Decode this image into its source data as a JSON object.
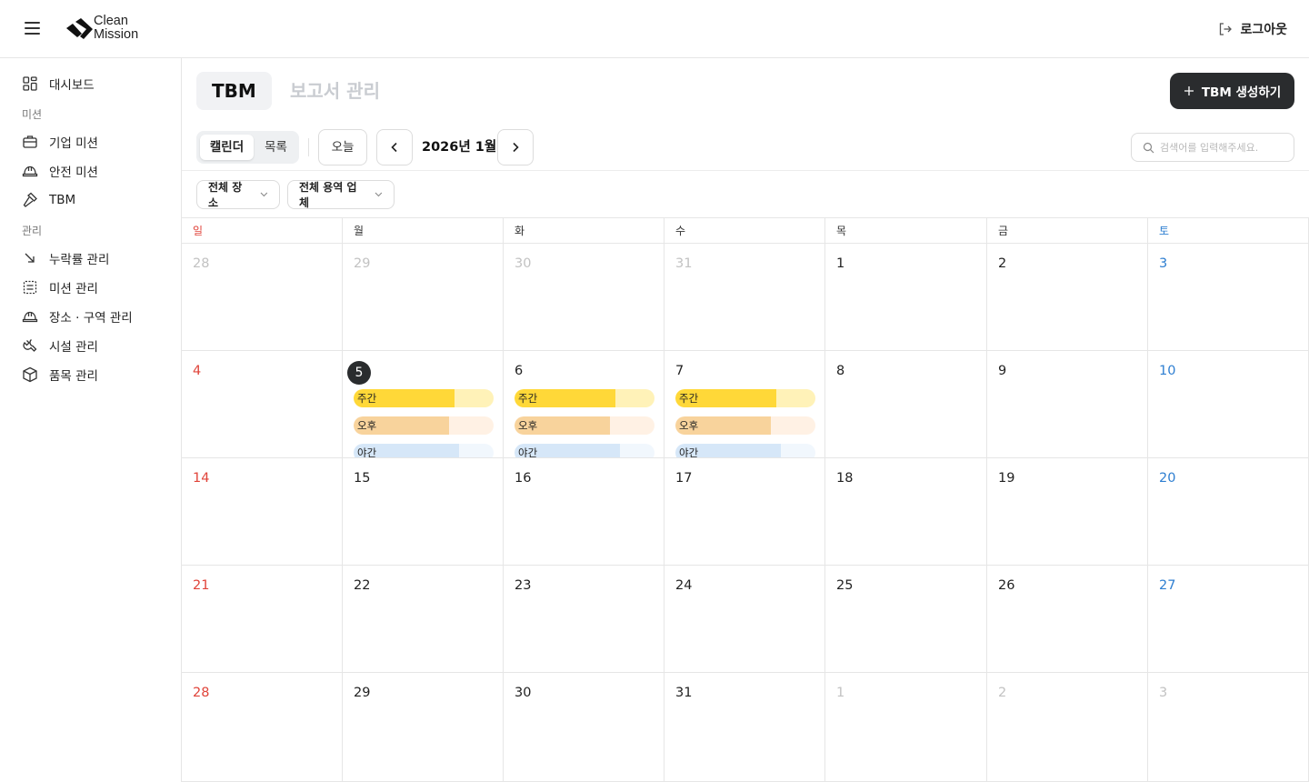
{
  "header": {
    "logo_line1": "Clean",
    "logo_line2": "Mission",
    "logout_label": "로그아웃"
  },
  "sidebar": {
    "items": [
      {
        "label": "대시보드",
        "icon": "dashboard-icon"
      },
      {
        "label": "기업 미션",
        "icon": "briefcase-icon"
      },
      {
        "label": "안전 미션",
        "icon": "hardhat-icon"
      },
      {
        "label": "TBM",
        "icon": "hammer-icon"
      },
      {
        "label": "누락률 관리",
        "icon": "arrow-down-right-icon"
      },
      {
        "label": "미션 관리",
        "icon": "checklist-icon"
      },
      {
        "label": "장소 · 구역 관리",
        "icon": "hardhat-icon"
      },
      {
        "label": "시설 관리",
        "icon": "wrench-icon"
      },
      {
        "label": "품목 관리",
        "icon": "box-icon"
      }
    ],
    "sections": [
      "미션",
      "관리"
    ]
  },
  "tabs": {
    "active": "TBM",
    "inactive": "보고서 관리"
  },
  "create_button_label": "TBM 생성하기",
  "view_toggle": {
    "calendar": "캘린더",
    "list": "목록"
  },
  "today_label": "오늘",
  "month_title": "2026년 1월",
  "search_placeholder": "검색어를 입력해주세요.",
  "filters": {
    "location": "전체 장소",
    "vendor": "전체 용역 업체"
  },
  "calendar": {
    "weekdays": [
      "일",
      "월",
      "화",
      "수",
      "목",
      "금",
      "토"
    ],
    "weeks": [
      [
        {
          "d": "28",
          "o": true
        },
        {
          "d": "29",
          "o": true
        },
        {
          "d": "30",
          "o": true
        },
        {
          "d": "31",
          "o": true
        },
        {
          "d": "1"
        },
        {
          "d": "2"
        },
        {
          "d": "3"
        }
      ],
      [
        {
          "d": "4"
        },
        {
          "d": "5",
          "today": true
        },
        {
          "d": "6"
        },
        {
          "d": "7"
        },
        {
          "d": "8"
        },
        {
          "d": "9"
        },
        {
          "d": "10"
        }
      ],
      [
        {
          "d": "14"
        },
        {
          "d": "15"
        },
        {
          "d": "16"
        },
        {
          "d": "17"
        },
        {
          "d": "18"
        },
        {
          "d": "19"
        },
        {
          "d": "20"
        }
      ],
      [
        {
          "d": "21"
        },
        {
          "d": "22"
        },
        {
          "d": "23"
        },
        {
          "d": "24"
        },
        {
          "d": "25"
        },
        {
          "d": "26"
        },
        {
          "d": "27"
        }
      ],
      [
        {
          "d": "28"
        },
        {
          "d": "29"
        },
        {
          "d": "30"
        },
        {
          "d": "31"
        },
        {
          "d": "1",
          "o": true
        },
        {
          "d": "2",
          "o": true
        },
        {
          "d": "3",
          "o": true
        }
      ]
    ],
    "shift_days": [
      "5",
      "6",
      "7"
    ],
    "shifts": [
      {
        "label": "주간",
        "progress": 0.72,
        "fill": "#ffd838",
        "track": "#fff2b8"
      },
      {
        "label": "오후",
        "progress": 0.68,
        "fill": "#f8d39c",
        "track": "#fff1e4"
      },
      {
        "label": "야간",
        "progress": 0.75,
        "fill": "#d6e7f8",
        "track": "#f1f7fd"
      }
    ]
  },
  "colors": {
    "sunday": "#e0443a",
    "saturday": "#2f7fd1",
    "primary_dark": "#2a2c2e"
  }
}
